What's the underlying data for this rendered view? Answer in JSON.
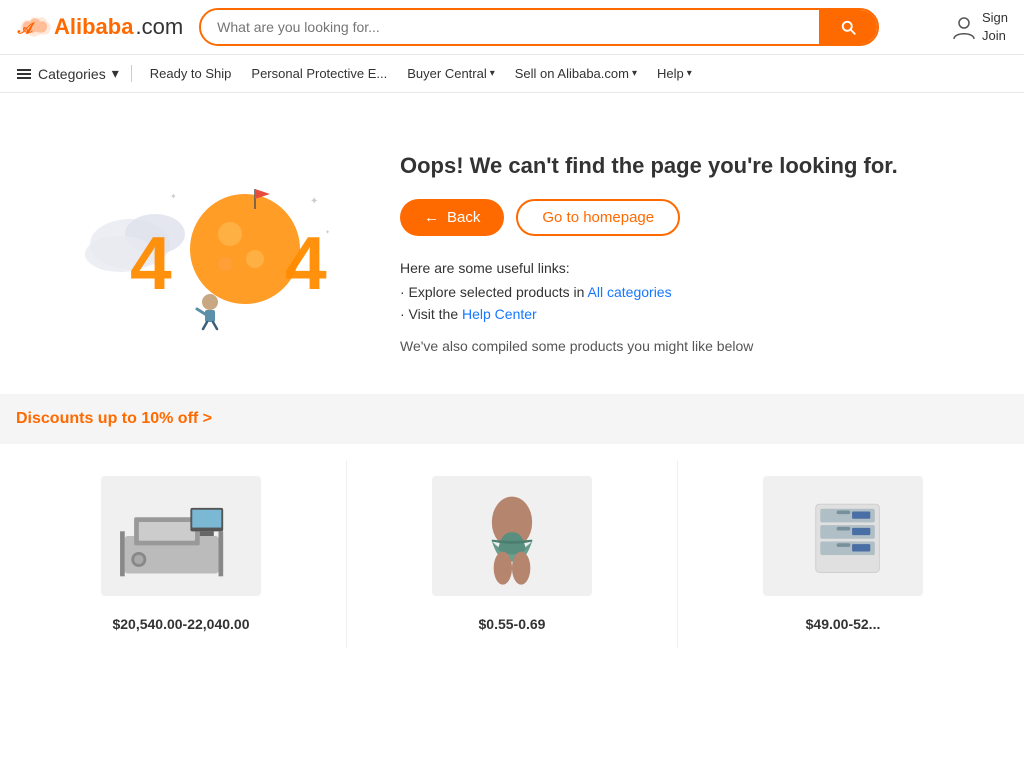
{
  "header": {
    "logo_text": ".com",
    "logo_brand": "Alibaba",
    "search_placeholder": "What are you looking for...",
    "user_sign": "Sign",
    "user_join": "Join"
  },
  "nav": {
    "categories_label": "Categories",
    "items": [
      {
        "label": "Ready to Ship",
        "hasArrow": false
      },
      {
        "label": "Personal Protective E...",
        "hasArrow": false
      },
      {
        "label": "Buyer Central",
        "hasArrow": true
      },
      {
        "label": "Sell on Alibaba.com",
        "hasArrow": true
      },
      {
        "label": "Help",
        "hasArrow": true
      }
    ]
  },
  "error_page": {
    "title": "Oops! We can't find the page you're looking for.",
    "back_label": "Back",
    "homepage_label": "Go to homepage",
    "useful_links_heading": "Here are some useful links:",
    "explore_text": "· Explore selected products in ",
    "explore_link_label": "All categories",
    "visit_text": "· Visit the ",
    "visit_link_label": "Help Center",
    "compiled_text": "We've also compiled some products you might like below"
  },
  "discounts": {
    "title": "Discounts up to 10% off >"
  },
  "products": [
    {
      "price": "$20,540.00-22,040.00",
      "type": "machine"
    },
    {
      "price": "$0.55-0.69",
      "type": "clothing"
    },
    {
      "price": "$49.00-52...",
      "type": "storage"
    }
  ]
}
